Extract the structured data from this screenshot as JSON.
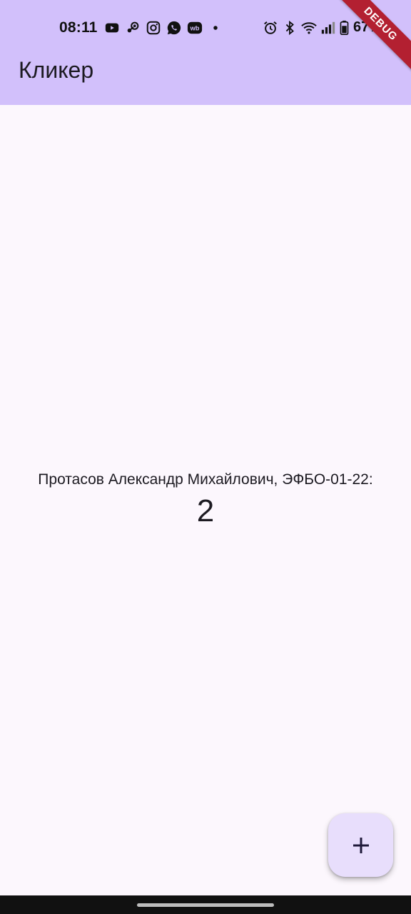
{
  "status_bar": {
    "time": "08:11",
    "battery_percent": "67%",
    "left_icons": [
      "youtube-icon",
      "steam-icon",
      "instagram-icon",
      "whatsapp-icon",
      "wb-icon",
      "dot-icon"
    ],
    "right_icons": [
      "alarm-icon",
      "bluetooth-icon",
      "wifi-icon",
      "signal-icon",
      "battery-icon"
    ],
    "wb_text": "wb"
  },
  "app_bar": {
    "title": "Кликер",
    "background": "#d2c0fb"
  },
  "debug_banner": {
    "label": "DEBUG",
    "color": "#b32031"
  },
  "main": {
    "counter_label": "Протасов Александр Михайлович, ЭФБО-01-22:",
    "counter_value": "2"
  },
  "fab": {
    "icon": "plus-icon",
    "background": "#e8defc"
  }
}
